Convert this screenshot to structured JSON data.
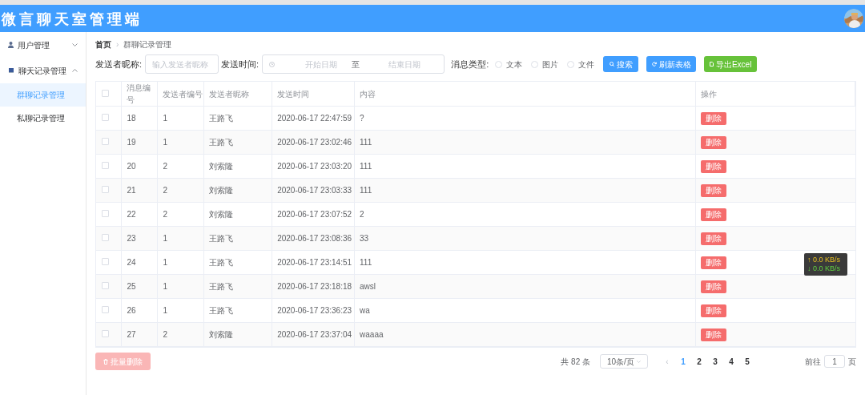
{
  "header": {
    "title": "微言聊天室管理端"
  },
  "sidebar": {
    "items": [
      {
        "label": "用户管理",
        "expanded": false,
        "selected": false
      },
      {
        "label": "聊天记录管理",
        "expanded": true,
        "selected": false,
        "children": [
          {
            "label": "群聊记录管理",
            "selected": true
          },
          {
            "label": "私聊记录管理",
            "selected": false
          }
        ]
      }
    ]
  },
  "breadcrumb": [
    "首页",
    "群聊记录管理"
  ],
  "breadcrumb_separator": "›",
  "filters": {
    "nickname_label": "发送者昵称:",
    "nickname_placeholder": "输入发送者昵称",
    "time_label": "发送时间:",
    "start_placeholder": "开始日期",
    "separator": "至",
    "end_placeholder": "结束日期",
    "type_label": "消息类型:",
    "types": [
      {
        "label": "文本",
        "selected": false
      },
      {
        "label": "图片",
        "selected": false
      },
      {
        "label": "文件",
        "selected": false
      }
    ],
    "buttons": [
      {
        "label": "搜索",
        "kind": "search"
      },
      {
        "label": "刷新表格",
        "kind": "refresh"
      },
      {
        "label": "导出Excel",
        "kind": "export"
      }
    ]
  },
  "table": {
    "header_checked": false,
    "columns": [
      "消息编号",
      "发送者编号",
      "发送者昵称",
      "发送时间",
      "内容",
      "操作"
    ],
    "rows": [
      {
        "id": "18",
        "sender_id": "1",
        "nickname": "王路飞",
        "time": "2020-06-17 22:47:59",
        "content": "?",
        "checked": false,
        "action": "删除"
      },
      {
        "id": "19",
        "sender_id": "1",
        "nickname": "王路飞",
        "time": "2020-06-17 23:02:46",
        "content": "111",
        "checked": false,
        "action": "删除"
      },
      {
        "id": "20",
        "sender_id": "2",
        "nickname": "刘索隆",
        "time": "2020-06-17 23:03:20",
        "content": "111",
        "checked": false,
        "action": "删除"
      },
      {
        "id": "21",
        "sender_id": "2",
        "nickname": "刘索隆",
        "time": "2020-06-17 23:03:33",
        "content": "111",
        "checked": false,
        "action": "删除"
      },
      {
        "id": "22",
        "sender_id": "2",
        "nickname": "刘索隆",
        "time": "2020-06-17 23:07:52",
        "content": "2",
        "checked": false,
        "action": "删除"
      },
      {
        "id": "23",
        "sender_id": "1",
        "nickname": "王路飞",
        "time": "2020-06-17 23:08:36",
        "content": "33",
        "checked": false,
        "action": "删除"
      },
      {
        "id": "24",
        "sender_id": "1",
        "nickname": "王路飞",
        "time": "2020-06-17 23:14:51",
        "content": "111",
        "checked": false,
        "action": "删除"
      },
      {
        "id": "25",
        "sender_id": "1",
        "nickname": "王路飞",
        "time": "2020-06-17 23:18:18",
        "content": "awsl",
        "checked": false,
        "action": "删除"
      },
      {
        "id": "26",
        "sender_id": "1",
        "nickname": "王路飞",
        "time": "2020-06-17 23:36:23",
        "content": "wa",
        "checked": false,
        "action": "删除"
      },
      {
        "id": "27",
        "sender_id": "2",
        "nickname": "刘索隆",
        "time": "2020-06-17 23:37:04",
        "content": "waaaa",
        "checked": false,
        "action": "删除"
      }
    ]
  },
  "batch_delete": {
    "label": "批量删除",
    "disabled": true
  },
  "pagination": {
    "total": "共 82 条",
    "page_size": "10条/页",
    "prev": "‹",
    "pages": [
      {
        "label": "1",
        "selected": true
      },
      {
        "label": "2",
        "selected": false
      },
      {
        "label": "3",
        "selected": false
      },
      {
        "label": "4",
        "selected": false
      },
      {
        "label": "5",
        "selected": false
      }
    ],
    "jump_label": "前往",
    "jump_value": "1",
    "jump_suffix": "页"
  },
  "net_speed": {
    "up": "↑ 0.0 KB/s",
    "down": "↓ 0.0 KB/s"
  }
}
